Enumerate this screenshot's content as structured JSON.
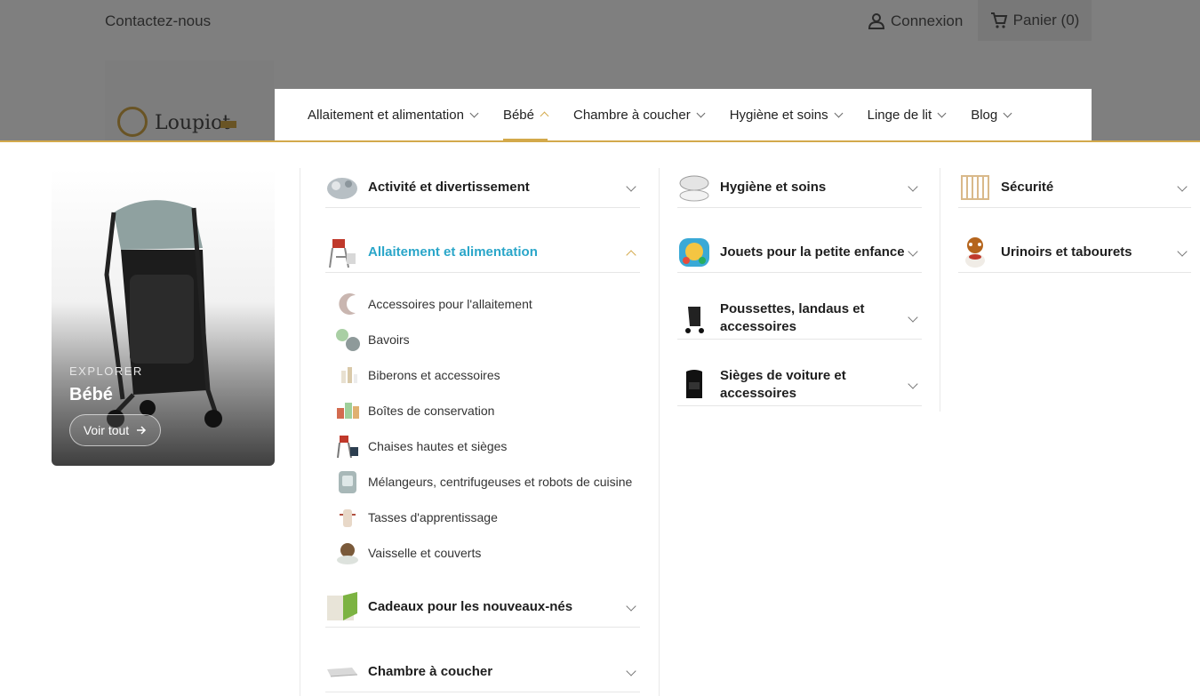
{
  "header": {
    "contact": "Contactez-nous",
    "login": "Connexion",
    "cart": "Panier (0)",
    "logo_text": "Loupiot"
  },
  "nav": [
    {
      "label": "Allaitement et alimentation"
    },
    {
      "label": "Bébé",
      "active": true
    },
    {
      "label": "Chambre à coucher"
    },
    {
      "label": "Hygiène et soins"
    },
    {
      "label": "Linge de lit"
    },
    {
      "label": "Blog"
    }
  ],
  "promo": {
    "eyebrow": "EXPLORER",
    "title": "Bébé",
    "button": "Voir tout"
  },
  "col1": {
    "activite": "Activité et divertissement",
    "allaitement": "Allaitement et alimentation",
    "subitems": [
      "Accessoires pour l'allaitement",
      "Bavoirs",
      "Biberons et accessoires",
      "Boîtes de conservation",
      "Chaises hautes et sièges",
      "Mélangeurs, centrifugeuses et robots de cuisine",
      "Tasses d'apprentissage",
      "Vaisselle et couverts"
    ],
    "cadeaux": "Cadeaux pour les nouveaux-nés",
    "chambre": "Chambre à coucher"
  },
  "col2": {
    "hygiene": "Hygiène et soins",
    "jouets": "Jouets pour la petite enfance",
    "poussettes": "Poussettes, landaus et accessoires",
    "sieges": "Sièges de voiture et accessoires"
  },
  "col3": {
    "securite": "Sécurité",
    "urinoirs": "Urinoirs et tabourets"
  },
  "colors": {
    "accent": "#d3a94b",
    "open_category": "#2aa6c9"
  }
}
